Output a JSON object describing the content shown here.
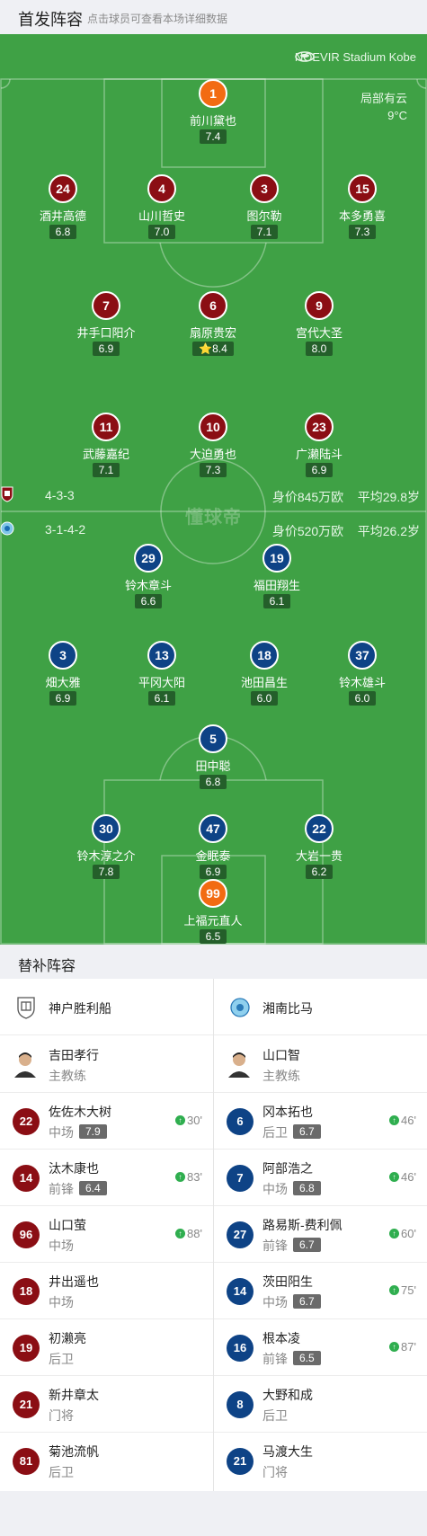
{
  "header": {
    "title": "首发阵容",
    "subtitle": "点击球员可查看本场详细数据"
  },
  "stadium": "NOEVIR Stadium Kobe",
  "weather": {
    "condition": "局部有云",
    "temp": "9°C"
  },
  "watermark": "懂球帝",
  "home_team": {
    "formation": "4-3-3",
    "value": "身价845万欧",
    "avg_age": "平均29.8岁"
  },
  "away_team": {
    "formation": "3-1-4-2",
    "value": "身价520万欧",
    "avg_age": "平均26.2岁"
  },
  "home_players": [
    {
      "num": "1",
      "name": "前川黛也",
      "rating": "7.4",
      "gk": true
    },
    {
      "num": "24",
      "name": "酒井高德",
      "rating": "6.8"
    },
    {
      "num": "4",
      "name": "山川哲史",
      "rating": "7.0",
      "captain": true
    },
    {
      "num": "3",
      "name": "图尔勒",
      "rating": "7.1"
    },
    {
      "num": "15",
      "name": "本多勇喜",
      "rating": "7.3"
    },
    {
      "num": "7",
      "name": "井手口阳介",
      "rating": "6.9",
      "sub_min": "88'"
    },
    {
      "num": "6",
      "name": "扇原贵宏",
      "rating": "8.4",
      "goal": true,
      "best": true
    },
    {
      "num": "9",
      "name": "宫代大圣",
      "rating": "8.0",
      "sub_min": "83'",
      "goal": true
    },
    {
      "num": "11",
      "name": "武藤嘉纪",
      "rating": "7.1",
      "goal": true
    },
    {
      "num": "10",
      "name": "大迫勇也",
      "rating": "7.3",
      "assist": true
    },
    {
      "num": "23",
      "name": "广濑陆斗",
      "rating": "6.9",
      "sub_min": "30'"
    }
  ],
  "away_players": [
    {
      "num": "29",
      "name": "铃木章斗",
      "rating": "6.6",
      "sub_min": "87'"
    },
    {
      "num": "19",
      "name": "福田翔生",
      "rating": "6.1"
    },
    {
      "num": "3",
      "name": "畑大雅",
      "rating": "6.9"
    },
    {
      "num": "13",
      "name": "平冈大阳",
      "rating": "6.1",
      "sub_min": "46'"
    },
    {
      "num": "18",
      "name": "池田昌生",
      "rating": "6.0",
      "sub_min": "60'"
    },
    {
      "num": "37",
      "name": "铃木雄斗",
      "rating": "6.0",
      "sub_min": "75'"
    },
    {
      "num": "5",
      "name": "田中聪",
      "rating": "6.8",
      "yellow": true
    },
    {
      "num": "30",
      "name": "铃木淳之介",
      "rating": "7.8"
    },
    {
      "num": "47",
      "name": "金眠泰",
      "rating": "6.9",
      "captain": true
    },
    {
      "num": "22",
      "name": "大岩一贵",
      "rating": "6.2",
      "sub_min": "46'"
    },
    {
      "num": "99",
      "name": "上福元直人",
      "rating": "6.5",
      "gk": true
    }
  ],
  "subs_header": "替补阵容",
  "subs": {
    "home": {
      "team": "神户胜利船",
      "coach": {
        "name": "吉田孝行",
        "role": "主教练"
      },
      "players": [
        {
          "num": "22",
          "name": "佐佐木大树",
          "pos": "中场",
          "rating": "7.9",
          "in": "30'"
        },
        {
          "num": "14",
          "name": "汰木康也",
          "pos": "前锋",
          "rating": "6.4",
          "in": "83'"
        },
        {
          "num": "96",
          "name": "山口萤",
          "pos": "中场",
          "rating": "",
          "in": "88'"
        },
        {
          "num": "18",
          "name": "井出遥也",
          "pos": "中场",
          "rating": "",
          "in": ""
        },
        {
          "num": "19",
          "name": "初濑亮",
          "pos": "后卫",
          "rating": "",
          "in": ""
        },
        {
          "num": "21",
          "name": "新井章太",
          "pos": "门将",
          "rating": "",
          "in": ""
        },
        {
          "num": "81",
          "name": "菊池流帆",
          "pos": "后卫",
          "rating": "",
          "in": ""
        }
      ]
    },
    "away": {
      "team": "湘南比马",
      "coach": {
        "name": "山口智",
        "role": "主教练"
      },
      "players": [
        {
          "num": "6",
          "name": "冈本拓也",
          "pos": "后卫",
          "rating": "6.7",
          "in": "46'"
        },
        {
          "num": "7",
          "name": "阿部浩之",
          "pos": "中场",
          "rating": "6.8",
          "in": "46'"
        },
        {
          "num": "27",
          "name": "路易斯-费利佩",
          "pos": "前锋",
          "rating": "6.7",
          "in": "60'"
        },
        {
          "num": "14",
          "name": "茨田阳生",
          "pos": "中场",
          "rating": "6.7",
          "in": "75'"
        },
        {
          "num": "16",
          "name": "根本凌",
          "pos": "前锋",
          "rating": "6.5",
          "in": "87'"
        },
        {
          "num": "8",
          "name": "大野和成",
          "pos": "后卫",
          "rating": "",
          "in": ""
        },
        {
          "num": "21",
          "name": "马渡大生",
          "pos": "门将",
          "rating": "",
          "in": ""
        }
      ]
    }
  }
}
